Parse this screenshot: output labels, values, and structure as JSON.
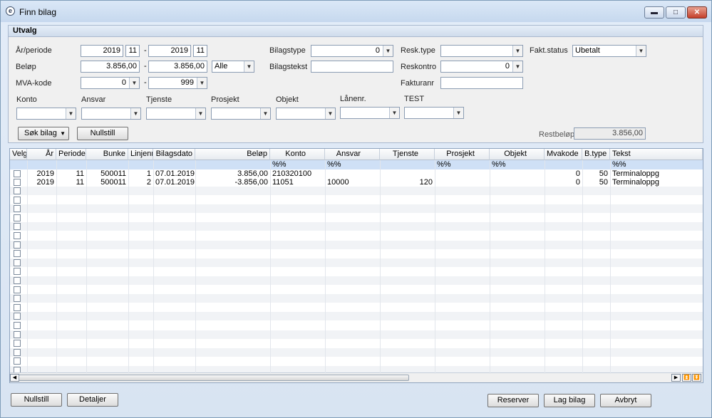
{
  "window": {
    "title": "Finn bilag",
    "minimize": "▬",
    "maximize": "□",
    "close": "✕"
  },
  "selection": {
    "title": "Utvalg",
    "year_period_label": "År/periode",
    "year_from": "2019",
    "period_from": "11",
    "dash": "-",
    "year_to": "2019",
    "period_to": "11",
    "amount_label": "Beløp",
    "amount_from": "3.856,00",
    "amount_to": "3.856,00",
    "amount_mode": "Alle",
    "vat_label": "MVA-kode",
    "vat_from": "0",
    "vat_to": "999",
    "voucher_type_label": "Bilagstype",
    "voucher_type_value": "0",
    "voucher_text_label": "Bilagstekst",
    "voucher_text_value": "",
    "resk_type_label": "Resk.type",
    "resk_type_value": "",
    "reskontro_label": "Reskontro",
    "reskontro_value": "0",
    "invoice_no_label": "Fakturanr",
    "invoice_no_value": "",
    "invoice_status_label": "Fakt.status",
    "invoice_status_value": "Ubetalt",
    "dims": [
      {
        "label": "Konto",
        "value": ""
      },
      {
        "label": "Ansvar",
        "value": ""
      },
      {
        "label": "Tjenste",
        "value": ""
      },
      {
        "label": "Prosjekt",
        "value": ""
      },
      {
        "label": "Objekt",
        "value": ""
      },
      {
        "label": "Lånenr.",
        "value": ""
      },
      {
        "label": "TEST",
        "value": ""
      }
    ],
    "search_button": "Søk bilag",
    "reset_button": "Nullstill",
    "remaining_label": "Restbeløp",
    "remaining_value": "3.856,00"
  },
  "grid": {
    "columns": [
      "Velg",
      "År",
      "Periode",
      "Bunke",
      "Linjenr",
      "Bilagsdato",
      "Beløp",
      "Konto",
      "Ansvar",
      "Tjenste",
      "Prosjekt",
      "Objekt",
      "Mvakode",
      "B.type",
      "Tekst"
    ],
    "filters": {
      "konto": "%%",
      "ansvar": "%%",
      "prosjekt": "%%",
      "objekt": "%%",
      "tekst": "%%"
    },
    "rows": [
      {
        "year": "2019",
        "period": "11",
        "batch": "500011",
        "line": "1",
        "date": "07.01.2019",
        "amount": "3.856,00",
        "account": "210320100",
        "ansvar": "",
        "tjeneste": "",
        "prosjekt": "",
        "objekt": "",
        "mva": "0",
        "btype": "50",
        "text": "Terminaloppg"
      },
      {
        "year": "2019",
        "period": "11",
        "batch": "500011",
        "line": "2",
        "date": "07.01.2019",
        "amount": "-3.856,00",
        "account": "11051",
        "ansvar": "10000",
        "tjeneste": "120",
        "prosjekt": "",
        "objekt": "",
        "mva": "0",
        "btype": "50",
        "text": "Terminaloppg"
      }
    ]
  },
  "footer": {
    "reset_button": "Nullstill",
    "details_button": "Detaljer",
    "reserve_button": "Reserver",
    "create_button": "Lag bilag",
    "cancel_button": "Avbryt"
  }
}
